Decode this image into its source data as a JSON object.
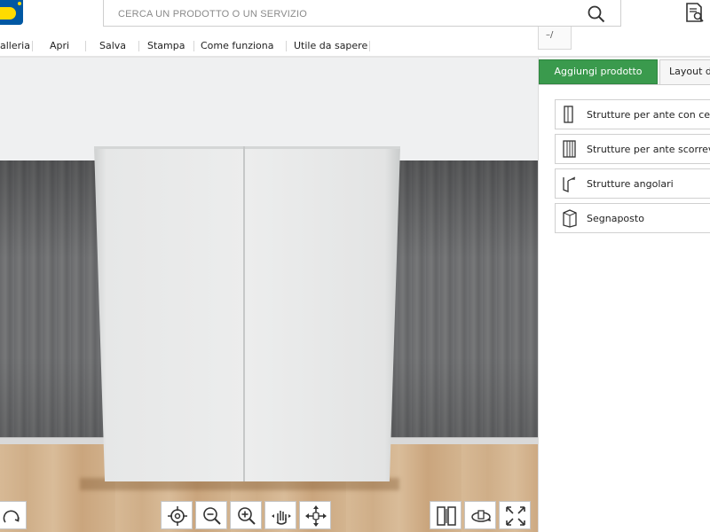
{
  "header": {
    "search": {
      "placeholder": "CERCA UN PRODOTTO O UN SERVIZIO"
    }
  },
  "menu": {
    "items": [
      {
        "label": "alleria"
      },
      {
        "label": "Apri"
      },
      {
        "label": "Salva"
      },
      {
        "label": "Stampa"
      },
      {
        "label": "Come funziona"
      },
      {
        "label": "Utile da sapere"
      }
    ]
  },
  "corner": {
    "label": "–/"
  },
  "panel": {
    "tabs": [
      {
        "label": "Aggiungi prodotto",
        "active": true
      },
      {
        "label": "Layout d"
      }
    ],
    "options": [
      {
        "label": "Strutture per ante con cer",
        "icon": "hinged-frame-icon"
      },
      {
        "label": "Strutture per ante scorreve",
        "icon": "sliding-frame-icon"
      },
      {
        "label": "Strutture angolari",
        "icon": "corner-frame-icon"
      },
      {
        "label": "Segnaposto",
        "icon": "placeholder-box-icon"
      }
    ]
  },
  "toolbar": {
    "left": [
      "rotate-icon"
    ],
    "center": [
      "center-view-icon",
      "zoom-out-icon",
      "zoom-in-icon",
      "pan-hand-icon",
      "move-arrows-icon"
    ],
    "right": [
      "toggle-doors-icon",
      "rotate-360-icon",
      "fullscreen-icon"
    ]
  },
  "colors": {
    "brand_blue": "#0058a3",
    "brand_yellow": "#ffdb00",
    "tab_active": "#3a9a4d"
  }
}
